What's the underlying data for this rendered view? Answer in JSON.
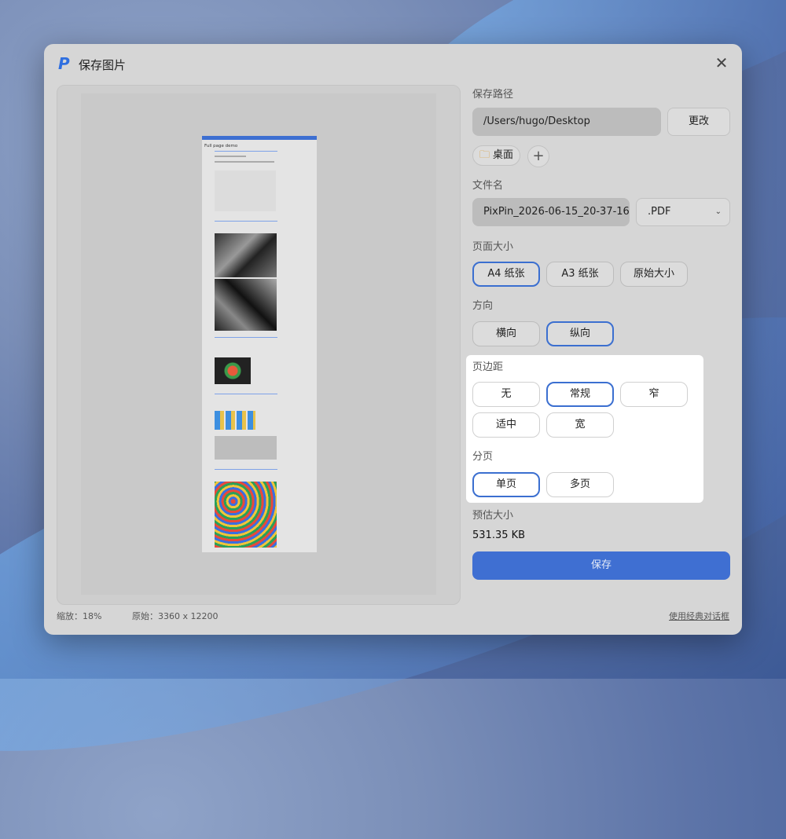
{
  "window": {
    "title": "保存图片",
    "close_glyph": "✕",
    "logo_glyph": "P"
  },
  "preview": {
    "thumbnail_title": "Full page demo"
  },
  "status": {
    "zoom": "缩放：18%",
    "original": "原始：3360 x 12200",
    "classic_dialog": "使用经典对话框"
  },
  "save_path": {
    "label": "保存路径",
    "value": "/Users/hugo/Desktop",
    "change_button": "更改",
    "folder_chip": "桌面",
    "folder_icon": "folder-icon",
    "add_glyph": "+"
  },
  "file_name": {
    "label": "文件名",
    "value": "PixPin_2026-06-15_20-37-16",
    "extension": ".PDF",
    "chevron_glyph": "⌄"
  },
  "page_size": {
    "label": "页面大小",
    "options": [
      "A4 纸张",
      "A3 纸张",
      "原始大小"
    ],
    "selected": "A4 纸张"
  },
  "orientation": {
    "label": "方向",
    "options": [
      "横向",
      "纵向"
    ],
    "selected": "纵向"
  },
  "margins": {
    "label": "页边距",
    "options": [
      "无",
      "常规",
      "窄",
      "适中",
      "宽"
    ],
    "selected": "常规"
  },
  "paging": {
    "label": "分页",
    "options": [
      "单页",
      "多页"
    ],
    "selected": "单页"
  },
  "estimate": {
    "label": "预估大小",
    "value": "531.35 KB"
  },
  "save_button": "保存",
  "colors": {
    "accent": "#3f6fd2",
    "window_bg": "#d6d6d6",
    "card_bg": "#ffffff"
  }
}
